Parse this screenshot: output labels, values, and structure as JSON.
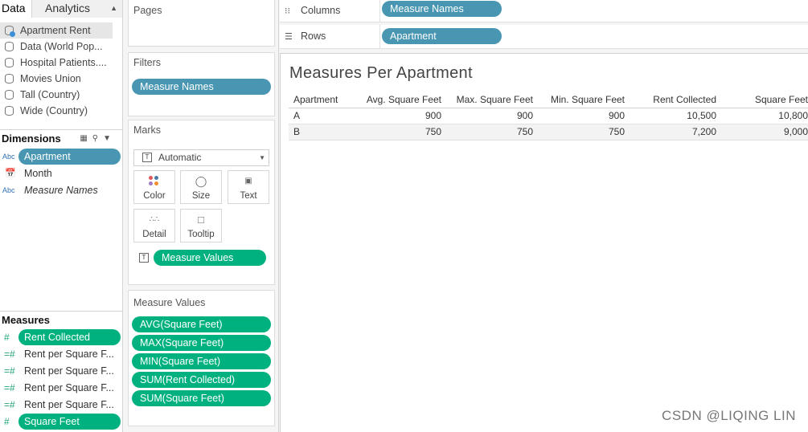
{
  "tabs": {
    "data": "Data",
    "analytics": "Analytics"
  },
  "data_sources": [
    {
      "label": "Apartment Rent",
      "selected": true
    },
    {
      "label": "Data (World Pop..."
    },
    {
      "label": "Hospital Patients...."
    },
    {
      "label": "Movies Union"
    },
    {
      "label": "Tall (Country)"
    },
    {
      "label": "Wide (Country)"
    }
  ],
  "dimensions": {
    "header": "Dimensions",
    "items": [
      {
        "type_icon": "Abc",
        "label": "Apartment"
      },
      {
        "type_icon": "calendar-icon",
        "label": "Month"
      },
      {
        "type_icon": "Abc",
        "label": "Measure Names"
      }
    ]
  },
  "measures": {
    "header": "Measures",
    "items": [
      {
        "label": "Rent Collected"
      },
      {
        "label": "Rent per Square F..."
      },
      {
        "label": "Rent per Square F..."
      },
      {
        "label": "Rent per Square F..."
      },
      {
        "label": "Rent per Square F..."
      },
      {
        "label": "Square Feet"
      }
    ]
  },
  "pages": {
    "title": "Pages"
  },
  "filters": {
    "title": "Filters",
    "pill": "Measure Names"
  },
  "marks": {
    "title": "Marks",
    "type": "Automatic",
    "buttons": {
      "color": "Color",
      "size": "Size",
      "text": "Text",
      "detail": "Detail",
      "tooltip": "Tooltip"
    },
    "pill": "Measure Values"
  },
  "measure_values": {
    "title": "Measure Values",
    "pills": [
      "AVG(Square Feet)",
      "MAX(Square Feet)",
      "MIN(Square Feet)",
      "SUM(Rent Collected)",
      "SUM(Square Feet)"
    ]
  },
  "columns": {
    "label": "Columns",
    "pill": "Measure Names"
  },
  "rows": {
    "label": "Rows",
    "pill": "Apartment"
  },
  "view": {
    "title": "Measures Per Apartment",
    "headers": [
      "Apartment",
      "Avg. Square Feet",
      "Max. Square Feet",
      "Min. Square Feet",
      "Rent Collected",
      "Square Feet"
    ],
    "rows": [
      [
        "A",
        "900",
        "900",
        "900",
        "10,500",
        "10,800"
      ],
      [
        "B",
        "750",
        "750",
        "750",
        "7,200",
        "9,000"
      ]
    ]
  },
  "watermark": "CSDN @LIQING LIN",
  "colors": {
    "dimension_pill": "#4996b2",
    "measure_pill": "#00b180"
  }
}
